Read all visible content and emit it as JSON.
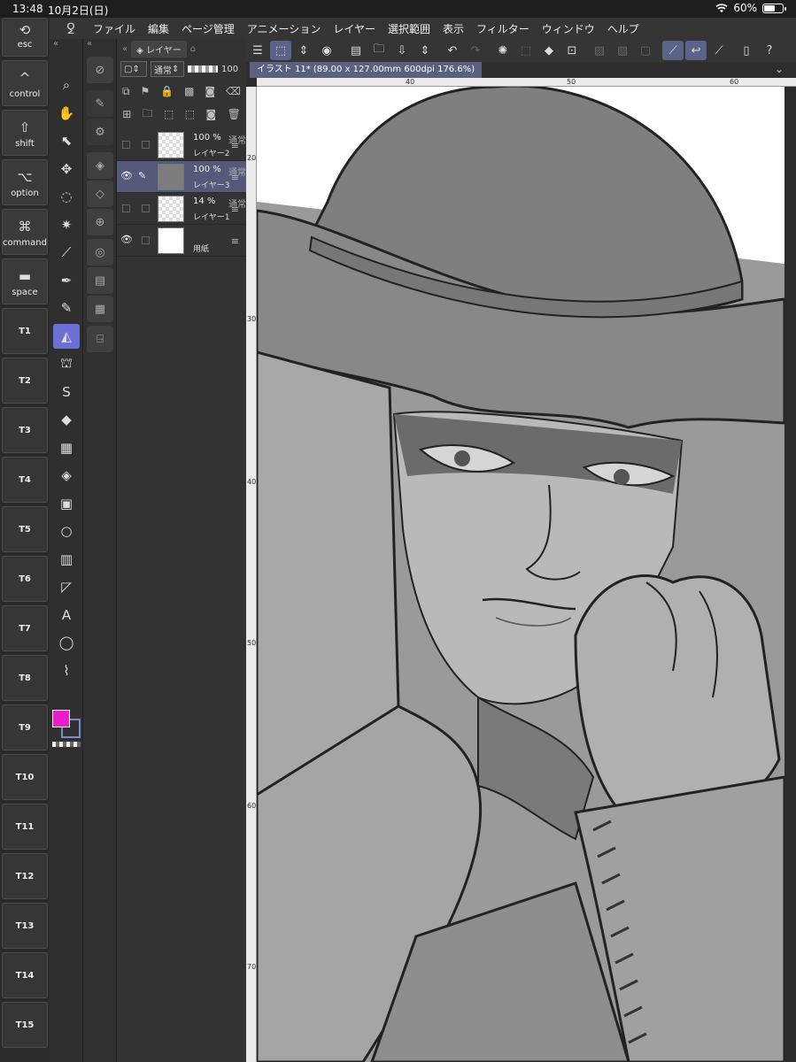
{
  "status": {
    "time": "13:48",
    "date": "10月2日(日)",
    "battery": "60%",
    "battery_level": 0.6
  },
  "menu": {
    "logo": "clip-studio-logo-icon",
    "items": [
      "ファイル",
      "編集",
      "ページ管理",
      "アニメーション",
      "レイヤー",
      "選択範囲",
      "表示",
      "フィルター",
      "ウィンドウ",
      "ヘルプ"
    ]
  },
  "keys": {
    "esc": "esc",
    "control": "control",
    "shift": "shift",
    "option": "option",
    "command": "command",
    "space": "space",
    "tkeys": [
      "T1",
      "T2",
      "T3",
      "T4",
      "T5",
      "T6",
      "T7",
      "T8",
      "T9",
      "T10",
      "T11",
      "T12",
      "T13",
      "T14",
      "T15"
    ]
  },
  "tools": {
    "list": [
      "zoom-icon",
      "hand-icon",
      "object-icon",
      "move-icon",
      "lasso-icon",
      "magic-wand-icon",
      "eyedropper-icon",
      "pen-icon",
      "pencil-icon",
      "brush-icon",
      "airbrush-icon",
      "decoration-icon",
      "eraser-icon",
      "blend-icon",
      "fill-icon",
      "gradient-icon",
      "figure-icon",
      "frame-icon",
      "ruler-icon",
      "text-icon",
      "balloon-icon",
      "correction-icon"
    ],
    "active_index": 9,
    "main_color": "#e81fc9",
    "sub_color": "#7a8bd0"
  },
  "layers": {
    "tab_label": "レイヤー",
    "blend_mode": "通常",
    "opacity": "100",
    "items": [
      {
        "opacity": "100 %",
        "blend": "通常",
        "name": "レイヤー2",
        "visible": false,
        "selected": false,
        "thumb": "checker"
      },
      {
        "opacity": "100 %",
        "blend": "通常",
        "name": "レイヤー3",
        "visible": true,
        "selected": true,
        "thumb": "dark"
      },
      {
        "opacity": "14 %",
        "blend": "通常",
        "name": "レイヤー1",
        "visible": false,
        "selected": false,
        "thumb": "checker"
      },
      {
        "opacity": "",
        "blend": "",
        "name": "用紙",
        "visible": true,
        "selected": false,
        "thumb": "white"
      }
    ]
  },
  "document": {
    "tab": "イラスト 11* (89.00 x 127.00mm 600dpi 176.6%)"
  },
  "rulers": {
    "top": [
      "40",
      "50",
      "60"
    ],
    "left": [
      "20",
      "30",
      "40",
      "50",
      "60",
      "70"
    ]
  },
  "colors": {
    "ui_bg": "#2b2b2b",
    "accent": "#5a6180",
    "active_tool": "#6c6fd6"
  }
}
